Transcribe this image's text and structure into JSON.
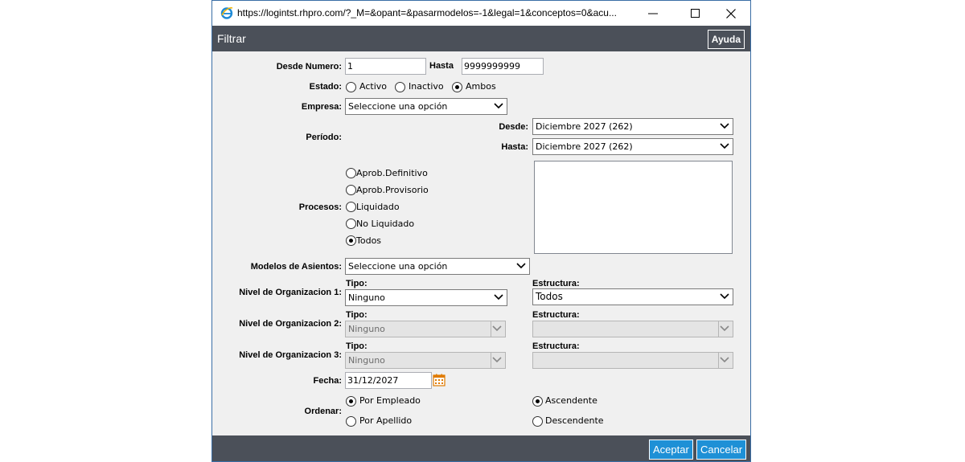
{
  "window": {
    "url": "https://logintst.rhpro.com/?_M=&opant=&pasarmodelos=-1&legal=1&conceptos=0&acu...",
    "minimize": "—",
    "maximize": "☐",
    "close": "✕"
  },
  "header": {
    "title": "Filtrar",
    "help_label": "Ayuda"
  },
  "form": {
    "desde_numero": {
      "label": "Desde Numero:",
      "value": "1",
      "hasta_label": "Hasta",
      "hasta_value": "9999999999"
    },
    "estado": {
      "label": "Estado:",
      "options": [
        "Activo",
        "Inactivo",
        "Ambos"
      ],
      "selected": "Ambos"
    },
    "empresa": {
      "label": "Empresa:",
      "value": "Seleccione una opción"
    },
    "periodo": {
      "label": "Período:",
      "desde_label": "Desde:",
      "desde_value": "Diciembre 2027 (262)",
      "hasta_label": "Hasta:",
      "hasta_value": "Diciembre 2027 (262)"
    },
    "procesos": {
      "label": "Procesos:",
      "options": [
        "Aprob.Definitivo",
        "Aprob.Provisorio",
        "Liquidado",
        "No Liquidado",
        "Todos"
      ],
      "selected": "Todos"
    },
    "modelos": {
      "label": "Modelos de Asientos:",
      "value": "Seleccione una opción"
    },
    "niveles": [
      {
        "label": "Nivel de Organizacion 1:",
        "tipo_label": "Tipo:",
        "tipo_value": "Ninguno",
        "estructura_label": "Estructura:",
        "estructura_value": "Todos",
        "enabled": true
      },
      {
        "label": "Nivel de Organizacion 2:",
        "tipo_label": "Tipo:",
        "tipo_value": "Ninguno",
        "estructura_label": "Estructura:",
        "estructura_value": "",
        "enabled": false
      },
      {
        "label": "Nivel de Organizacion 3:",
        "tipo_label": "Tipo:",
        "tipo_value": "Ninguno",
        "estructura_label": "Estructura:",
        "estructura_value": "",
        "enabled": false
      }
    ],
    "fecha": {
      "label": "Fecha:",
      "value": "31/12/2027"
    },
    "ordenar": {
      "label": "Ordenar:",
      "por_empleado": "Por Empleado",
      "por_apellido": "Por Apellido",
      "ascendente": "Ascendente",
      "descendente": "Descendente",
      "selected_order_by": "Por Empleado",
      "selected_direction": "Ascendente"
    }
  },
  "footer": {
    "accept_label": "Aceptar",
    "cancel_label": "Cancelar"
  },
  "colors": {
    "header_bg": "#4b5059",
    "button_blue": "#1e90d6",
    "body_bg": "#f0f0f0"
  }
}
